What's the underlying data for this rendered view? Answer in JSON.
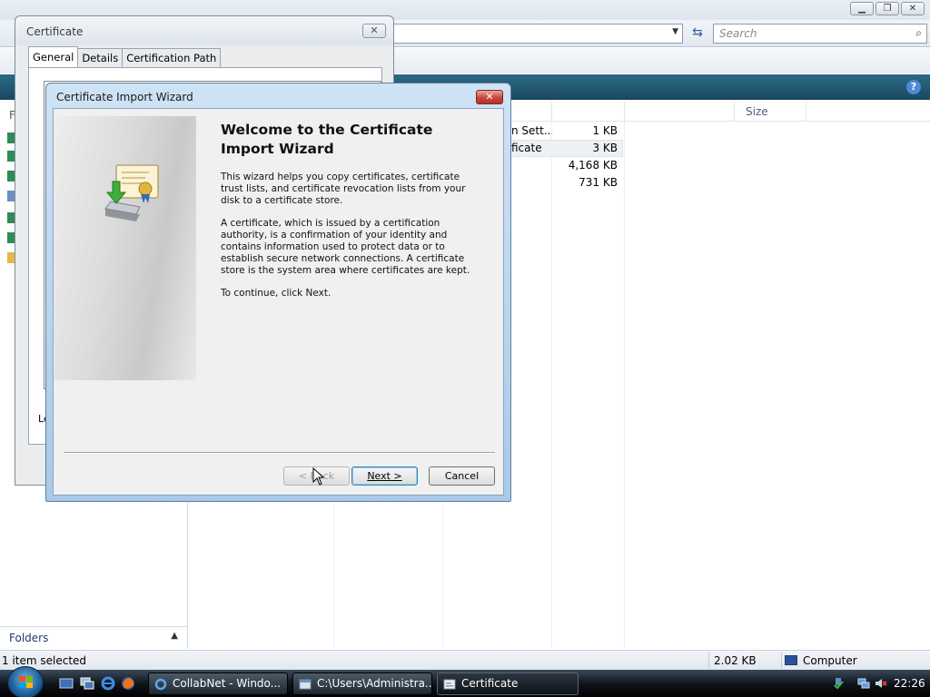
{
  "explorer": {
    "search_placeholder": "Search",
    "column_size": "Size",
    "rows": [
      {
        "type": "n Sett...",
        "size": "1 KB"
      },
      {
        "type": "ficate",
        "size": "3 KB"
      },
      {
        "type": "",
        "size": "4,168 KB"
      },
      {
        "type": "",
        "size": "731 KB"
      }
    ],
    "nav_letter": "F",
    "folders_label": "Folders",
    "status": {
      "selected": "1 item selected",
      "size": "2.02 KB",
      "location": "Computer"
    }
  },
  "certificate_window": {
    "title": "Certificate",
    "tabs": [
      "General",
      "Details",
      "Certification Path"
    ],
    "partial_label": "Le"
  },
  "wizard": {
    "title": "Certificate Import Wizard",
    "heading": "Welcome to the Certificate Import Wizard",
    "paragraph1": "This wizard helps you copy certificates, certificate trust lists, and certificate revocation lists from your disk to a certificate store.",
    "paragraph2": "A certificate, which is issued by a certification authority, is a confirmation of your identity and contains information used to protect data or to establish secure network connections. A certificate store is the system area where certificates are kept.",
    "paragraph3": "To continue, click Next.",
    "buttons": {
      "back": "< Back",
      "next": "Next >",
      "cancel": "Cancel"
    }
  },
  "taskbar": {
    "tasks": [
      {
        "label": "CollabNet - Windo...",
        "icon": "ie-icon",
        "active": false
      },
      {
        "label": "C:\\Users\\Administra...",
        "icon": "folder-window-icon",
        "active": false
      },
      {
        "label": "Certificate",
        "icon": "certificate-icon",
        "active": true
      }
    ],
    "clock": "22:26"
  }
}
